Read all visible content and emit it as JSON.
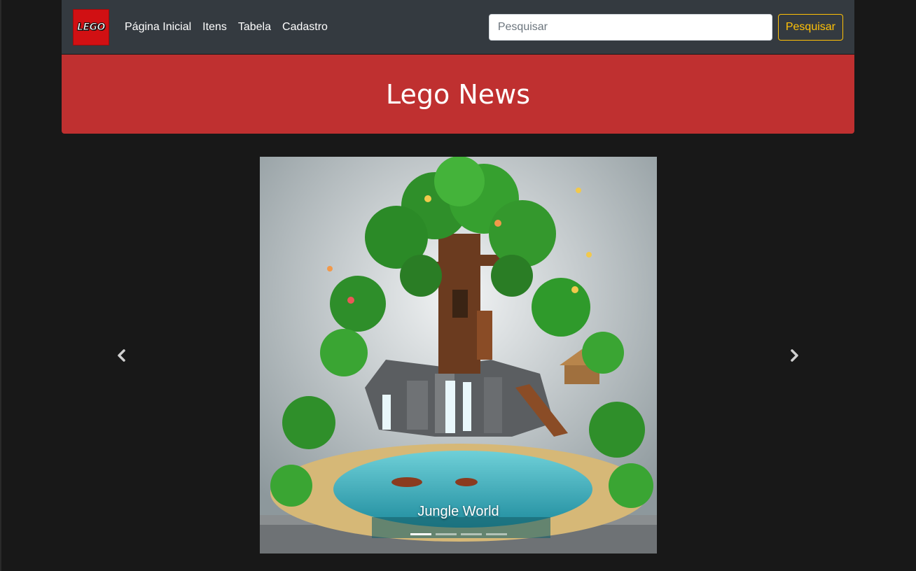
{
  "brand": {
    "logo_text": "LEGO",
    "logo_color": "#d11013"
  },
  "nav": {
    "links": [
      "Página Inicial",
      "Itens",
      "Tabela",
      "Cadastro"
    ]
  },
  "search": {
    "placeholder": "Pesquisar",
    "value": "",
    "button_label": "Pesquisar",
    "button_color": "#ffc107"
  },
  "banner": {
    "title": "Lego News",
    "color": "#bf3030"
  },
  "carousel": {
    "active_index": 0,
    "slide_count": 4,
    "caption": "Jungle World",
    "prev_icon": "chevron-left-icon",
    "next_icon": "chevron-right-icon"
  },
  "colors": {
    "page_background": "#181818",
    "navbar_background": "#343a40"
  }
}
